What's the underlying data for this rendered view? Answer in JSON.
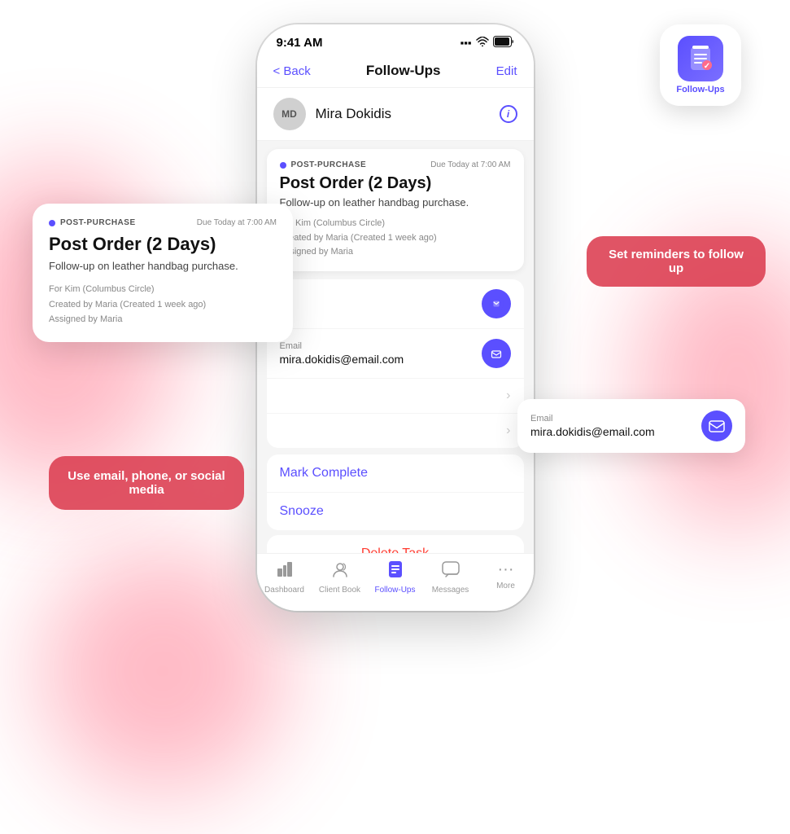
{
  "app_icon": {
    "label": "Follow-Ups",
    "bg_color": "#5b4fff"
  },
  "status_bar": {
    "time": "9:41 AM",
    "signal": "▪▪▪",
    "wifi": "wifi",
    "battery": "100"
  },
  "nav": {
    "back_label": "< Back",
    "title": "Follow-Ups",
    "edit_label": "Edit"
  },
  "contact": {
    "initials": "MD",
    "name": "Mira Dokidis"
  },
  "task": {
    "type": "POST-PURCHASE",
    "due": "Due Today at 7:00 AM",
    "title": "Post Order (2 Days)",
    "description": "Follow-up on leather handbag purchase.",
    "for": "For Kim (Columbus Circle)",
    "created_by": "Created by Maria (Created 1 week ago)",
    "assigned_by": "Assigned by Maria"
  },
  "contact_rows": [
    {
      "label": "Email",
      "value": "mira.dokidis@email.com",
      "has_action": true
    },
    {
      "label": "",
      "value": "",
      "has_chevron": true
    },
    {
      "label": "",
      "value": "",
      "has_chevron": true
    }
  ],
  "actions": [
    {
      "label": "Mark Complete",
      "color": "#5b4fff",
      "type": "action"
    },
    {
      "label": "Snooze",
      "color": "#5b4fff",
      "type": "action"
    }
  ],
  "delete_label": "Delete Task",
  "tab_bar": {
    "items": [
      {
        "icon": "📊",
        "label": "Dashboard",
        "active": false
      },
      {
        "icon": "👤",
        "label": "Client Book",
        "active": false
      },
      {
        "icon": "📋",
        "label": "Follow-Ups",
        "active": true
      },
      {
        "icon": "💬",
        "label": "Messages",
        "active": false
      },
      {
        "icon": "•••",
        "label": "More",
        "active": false
      }
    ]
  },
  "tooltips": {
    "set_reminders": "Set reminders to follow up",
    "use_email": "Use email, phone, or social media"
  },
  "floating_email": {
    "label": "Email",
    "value": "mira.dokidis@email.com"
  }
}
